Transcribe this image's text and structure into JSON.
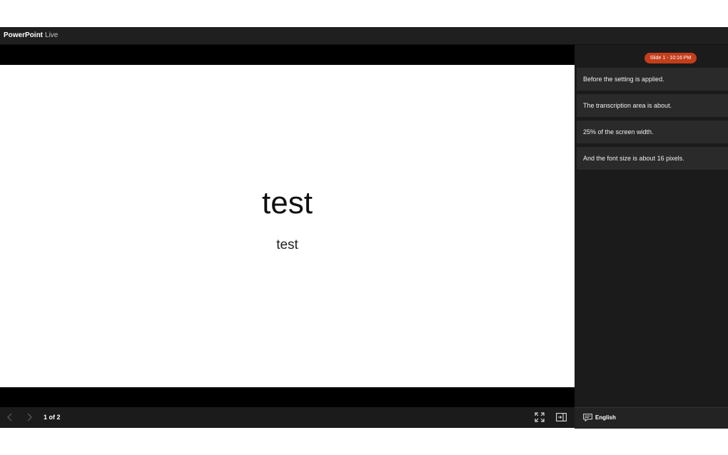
{
  "app": {
    "brand": "PowerPoint",
    "suffix": "Live"
  },
  "slide": {
    "title": "test",
    "subtitle": "test"
  },
  "navigation": {
    "prev_icon": "chevron-left-icon",
    "next_icon": "chevron-right-icon",
    "counter": "1 of 2",
    "fullscreen_icon": "fullscreen-icon",
    "panel_toggle_icon": "panel-toggle-icon"
  },
  "transcript": {
    "badge": "Slide 1 - 10:16 PM",
    "lines": [
      "Before the setting is applied.",
      "The transcription area is about.",
      "25% of the screen width.",
      "And the font size is about 16 pixels."
    ],
    "language_icon": "captions-icon",
    "language": "English"
  },
  "colors": {
    "badge": "#c43e1c",
    "panel": "#1b1b1b",
    "line_bg": "#2a2a2a"
  }
}
